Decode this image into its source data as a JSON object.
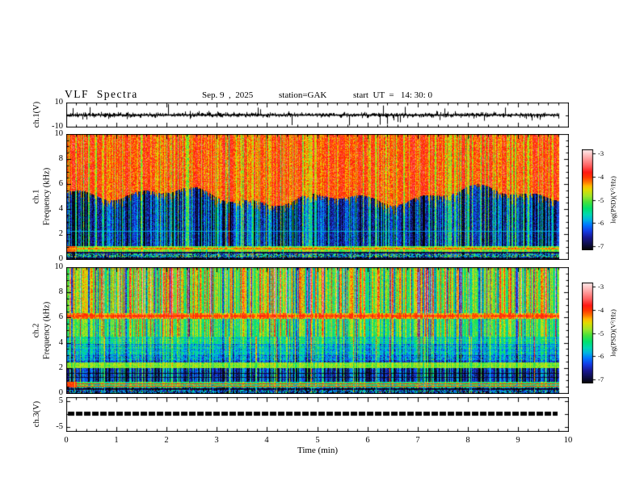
{
  "header": {
    "title": "VLF  Spectra",
    "date": "Sep. 9  ,  2025",
    "station": "station=GAK",
    "start_ut": "start  UT  =   14: 30: 0"
  },
  "x_axis": {
    "label": "Time  (min)",
    "xlim": [
      0,
      10
    ],
    "ticks": [
      "0",
      "1",
      "2",
      "3",
      "4",
      "5",
      "6",
      "7",
      "8",
      "9",
      "10"
    ],
    "minor_step": 0.2,
    "data_end_min": 9.8
  },
  "colormap": {
    "range": [
      -7,
      -3
    ],
    "stops": [
      [
        -7.0,
        [
          5,
          5,
          5
        ]
      ],
      [
        -6.75,
        [
          15,
          15,
          80
        ]
      ],
      [
        -6.5,
        [
          25,
          25,
          150
        ]
      ],
      [
        -6.25,
        [
          20,
          60,
          230
        ]
      ],
      [
        -6.0,
        [
          0,
          120,
          255
        ]
      ],
      [
        -5.8,
        [
          0,
          180,
          225
        ]
      ],
      [
        -5.6,
        [
          0,
          215,
          180
        ]
      ],
      [
        -5.35,
        [
          0,
          225,
          110
        ]
      ],
      [
        -5.1,
        [
          70,
          225,
          60
        ]
      ],
      [
        -4.85,
        [
          160,
          230,
          40
        ]
      ],
      [
        -4.6,
        [
          225,
          220,
          0
        ]
      ],
      [
        -4.45,
        [
          255,
          185,
          0
        ]
      ],
      [
        -4.3,
        [
          255,
          120,
          0
        ]
      ],
      [
        -4.1,
        [
          255,
          55,
          0
        ]
      ],
      [
        -3.9,
        [
          255,
          25,
          20
        ]
      ],
      [
        -3.65,
        [
          255,
          95,
          95
        ]
      ],
      [
        -3.4,
        [
          255,
          150,
          150
        ]
      ],
      [
        -3.2,
        [
          255,
          195,
          195
        ]
      ],
      [
        -3.0,
        [
          255,
          235,
          235
        ]
      ]
    ]
  },
  "chart_data": [
    {
      "id": "ch1_waveform",
      "type": "line",
      "ylabel": "ch.1(V)",
      "ylim": [
        -10,
        10
      ],
      "yticks": [
        {
          "value": 10,
          "label": "10"
        },
        {
          "value": -10,
          "label": "-10"
        }
      ],
      "description": "broadband VLF time series, dense noise of about +/-2 V with frequent impulsive sferic spikes reaching +/-10 V",
      "signal": {
        "seed": 11,
        "noise_sigma": 1.0,
        "spike_prob": 0.055,
        "spike_amp_min": 3.0,
        "spike_amp_max": 9.5,
        "downward_bias": 0.62
      }
    },
    {
      "id": "ch1_spectrogram",
      "type": "heatmap",
      "ylabel_lines": [
        "ch.1",
        "Frequency  (kHz)"
      ],
      "ylim": [
        0,
        10
      ],
      "yticks": [
        0,
        2,
        4,
        6,
        8,
        10
      ],
      "yminor_step": 0.5,
      "value_range": [
        -7,
        -3
      ],
      "colorbar": {
        "label": "log(PSD)(V²/Hz)",
        "ticks": [
          "-3",
          "-4",
          "-5",
          "-6",
          "-7"
        ]
      },
      "description": "intense red band (log PSD ~ -4) above ~5 kHz with yellow sferic streaks dipping to ~4.5 kHz; dark blue background (~-6.5) from 1-5 kHz crossed by dense cyan vertical sferic streaks; thin cyan line near 2.25 kHz; green band with orange line near 0.9 kHz; noisy speckled band below 0.6 kHz",
      "model": {
        "seed": 42,
        "boundary": {
          "base": 5.05,
          "wander": 1.0,
          "streak_dip": 0.7
        },
        "streaks": {
          "p_strong": 0.2,
          "p_med": 0.4,
          "dark_p": 0.08
        },
        "vline_p": 0.03,
        "bands": [
          {
            "fmin": "boundary",
            "fmax": 10,
            "base": -4.0,
            "noise": 0.35,
            "streak": -0.55
          },
          {
            "fmin": 1.05,
            "fmax": "boundary",
            "base": -6.55,
            "noise": 0.35,
            "streak": 0.9
          },
          {
            "fmin": 0.62,
            "fmax": 1.05,
            "base": -5.05,
            "noise": 0.3,
            "streak": 0.3,
            "left_hot": {
              "cols": 12,
              "value": -4.4
            }
          },
          {
            "fmin": 0.0,
            "fmax": 0.62,
            "base": -6.1,
            "noise": 1.1,
            "streak": 0.5,
            "hot_p": 0.015
          }
        ],
        "h_lines": [
          {
            "f": 2.25,
            "hw": 0.04,
            "value": -5.85
          },
          {
            "f": 0.86,
            "hw": 0.05,
            "value": -4.35
          },
          {
            "f": 0.55,
            "hw": 0.04,
            "value": -6.8
          },
          {
            "f": 0.12,
            "hw": 0.06,
            "value": -6.9
          }
        ]
      }
    },
    {
      "id": "ch2_spectrogram",
      "type": "heatmap",
      "ylabel_lines": [
        "ch.2",
        "Frequency  (kHz)"
      ],
      "ylim": [
        0,
        10
      ],
      "yticks": [
        0,
        2,
        4,
        6,
        8,
        10
      ],
      "yminor_step": 0.5,
      "value_range": [
        -7,
        -3
      ],
      "colorbar": {
        "label": "log(PSD)(V²/Hz)",
        "ticks": [
          "-3",
          "-4",
          "-5",
          "-6",
          "-7"
        ]
      },
      "description": "green field (~-5.1) above ~4.5 kHz streaked by yellow/orange/red sferic columns; continuous orange-red hiss band near 6-6.3 kHz; cyan/blue mottled 2.5-4.5 kHz; bright green double line near 2-2.4 kHz; dark blue 1-2 kHz with cyan streaks and black lines; green band with dark red power-line harmonics near 0.5-0.8 kHz; dark speckle below 0.5 kHz",
      "model": {
        "seed": 77,
        "streaks": {
          "p_strong": 0.16,
          "p_med": 0.42,
          "dark_p": 0.1
        },
        "vline_p": 0.04,
        "bands": [
          {
            "fmin": 6.35,
            "fmax": 10,
            "base": -5.1,
            "noise": 0.3,
            "streak": 1.1
          },
          {
            "fmin": 5.95,
            "fmax": 6.35,
            "base": -4.4,
            "noise": 0.25,
            "streak": 0.6
          },
          {
            "fmin": 4.55,
            "fmax": 5.95,
            "base": -5.3,
            "noise": 0.3,
            "streak": 0.8
          },
          {
            "fmin": 3.95,
            "fmax": 4.55,
            "base": -5.55,
            "noise": 0.3,
            "streak": 0.55,
            "rowstripe": 0.15
          },
          {
            "fmin": 3.05,
            "fmax": 3.95,
            "base": -5.8,
            "noise": 0.35,
            "streak": 0.5,
            "rowstripe": 0.3
          },
          {
            "fmin": 2.45,
            "fmax": 3.05,
            "base": -6.0,
            "noise": 0.4,
            "streak": 0.55,
            "rowstripe": 0.3
          },
          {
            "fmin": 2.0,
            "fmax": 2.45,
            "base": -5.0,
            "noise": 0.25,
            "streak": 0.3
          },
          {
            "fmin": 0.95,
            "fmax": 2.0,
            "base": -6.55,
            "noise": 0.3,
            "streak": 0.9
          },
          {
            "fmin": 0.5,
            "fmax": 0.95,
            "base": -5.35,
            "noise": 0.4,
            "streak": 0.4,
            "left_hot": {
              "cols": 12,
              "value": -4.3
            }
          },
          {
            "fmin": 0.0,
            "fmax": 0.5,
            "base": -6.35,
            "noise": 0.9,
            "streak": 0.4,
            "hot_p": 0.015
          }
        ],
        "h_lines": [
          {
            "f": 6.15,
            "hw": 0.09,
            "value": -4.15
          },
          {
            "f": 2.32,
            "hw": 0.05,
            "value": -4.9
          },
          {
            "f": 2.08,
            "hw": 0.05,
            "value": -4.95
          },
          {
            "f": 1.62,
            "hw": 0.03,
            "value": -6.95
          },
          {
            "f": 1.28,
            "hw": 0.03,
            "value": -6.9
          },
          {
            "f": 0.78,
            "hw": 0.03,
            "value": -4.1
          },
          {
            "f": 0.6,
            "hw": 0.03,
            "value": -4.05
          },
          {
            "f": 0.35,
            "hw": 0.04,
            "value": -6.9
          }
        ]
      }
    },
    {
      "id": "ch3_waveform",
      "type": "line",
      "ylabel": "ch.3(V)",
      "ylim": [
        -6.5,
        6.5
      ],
      "yticks": [
        {
          "value": 5,
          "label": "5"
        },
        {
          "value": -5,
          "label": "-5"
        }
      ],
      "description": "flat saturated trace near 0 V drawn as a thick dashed black bar spanning 0 to ~9.8 min",
      "signal": {
        "constant": 0.2,
        "bar_thickness_px": 5,
        "dash_on": 8,
        "dash_off": 2
      }
    }
  ]
}
